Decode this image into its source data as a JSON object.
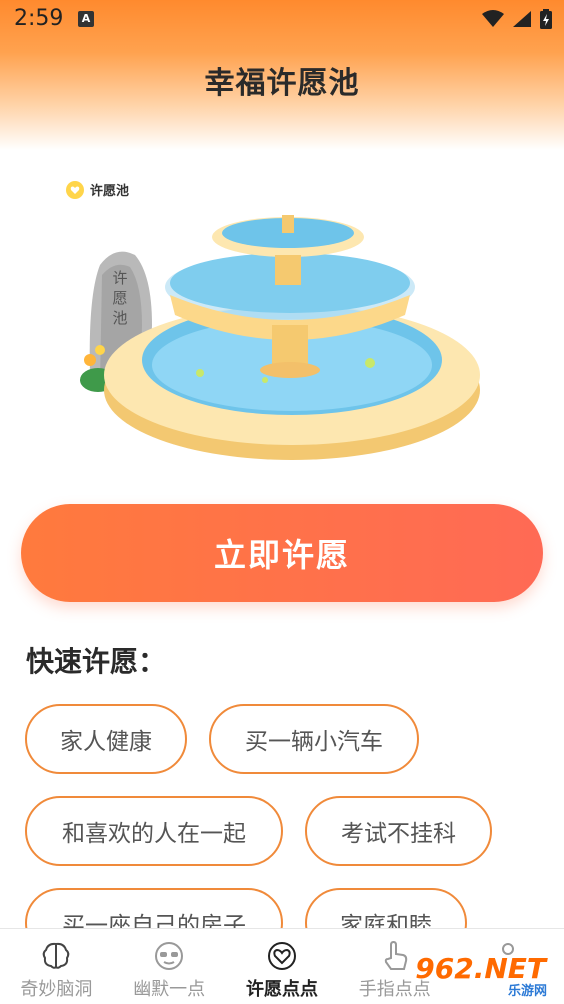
{
  "status_bar": {
    "time": "2:59",
    "notification_icon": "A"
  },
  "header": {
    "title": "幸福许愿池"
  },
  "illustration": {
    "label": "许愿池",
    "stone_text": "许愿池"
  },
  "wish_button": {
    "label": "立即许愿"
  },
  "quick_wish": {
    "title": "快速许愿：",
    "chips": [
      "家人健康",
      "买一辆小汽车",
      "和喜欢的人在一起",
      "考试不挂科",
      "买一座自己的房子",
      "家庭和睦"
    ]
  },
  "bottom_nav": {
    "items": [
      {
        "label": "奇妙脑洞",
        "icon": "brain-icon"
      },
      {
        "label": "幽默一点",
        "icon": "sunglasses-face-icon"
      },
      {
        "label": "许愿点点",
        "icon": "heart-icon",
        "active": true
      },
      {
        "label": "手指点点",
        "icon": "hand-pointer-icon"
      },
      {
        "label": "",
        "icon": "person-icon"
      }
    ]
  },
  "watermark": {
    "main": "962.NET",
    "sub": "乐游网"
  },
  "colors": {
    "accent": "#ff7a3d",
    "chip_border": "#f08a3a",
    "header_top": "#ff8a2e"
  }
}
